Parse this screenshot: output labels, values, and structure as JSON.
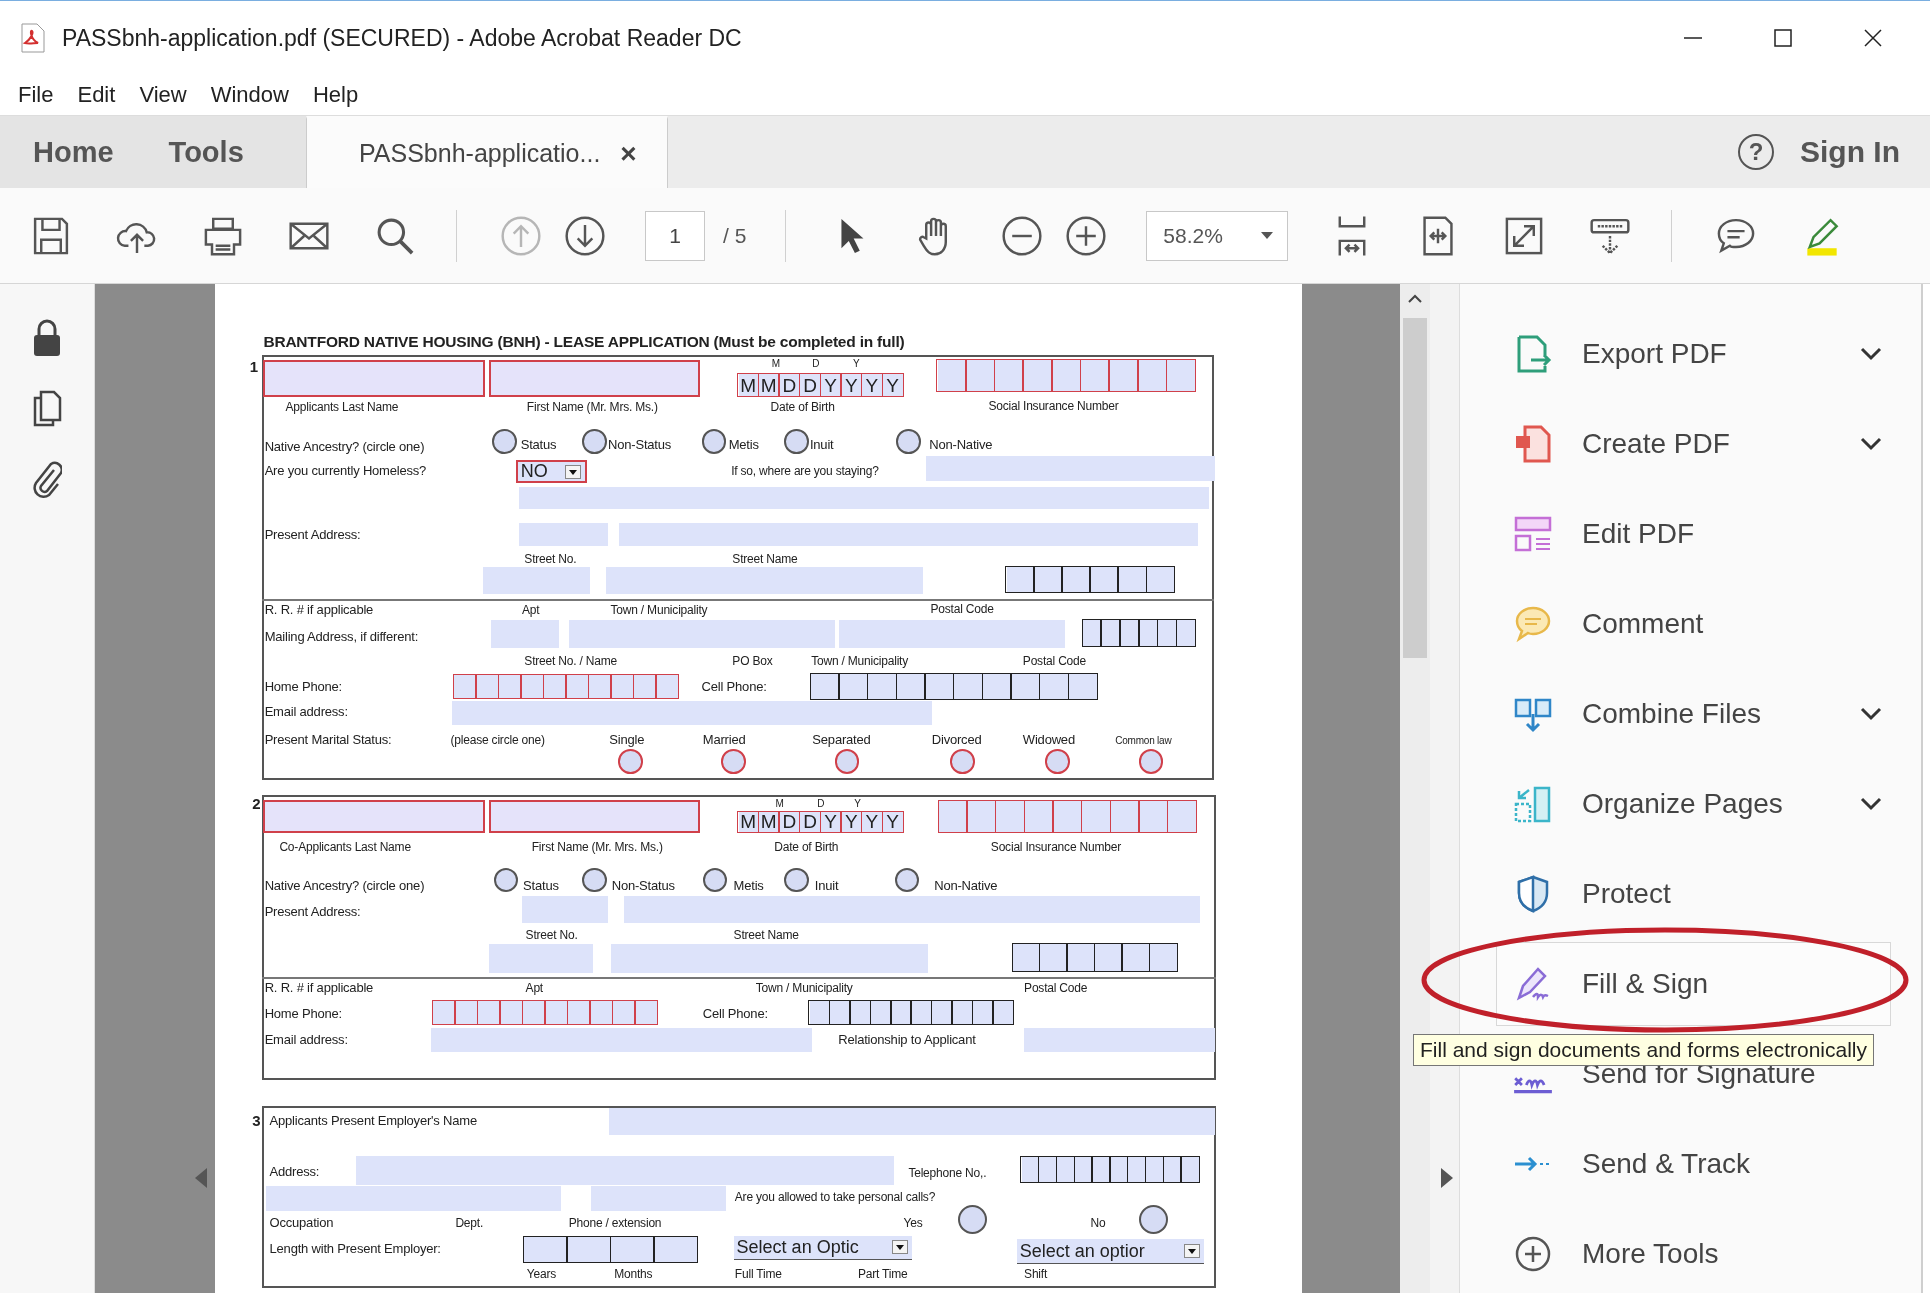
{
  "window": {
    "title": "PASSbnh-application.pdf (SECURED) - Adobe Acrobat Reader DC"
  },
  "menu": [
    "File",
    "Edit",
    "View",
    "Window",
    "Help"
  ],
  "tabs": [
    {
      "label": "Home",
      "selected": false
    },
    {
      "label": "Tools",
      "selected": false
    },
    {
      "label": "PASSbnh-applicatio...",
      "selected": true,
      "close": "×"
    }
  ],
  "help": "?",
  "sign_in": "Sign In",
  "toolbar": {
    "page": "1",
    "page_total": "/ 5",
    "zoom": "58.2%",
    "prev_disabled": true
  },
  "tools": [
    {
      "label": "Export PDF",
      "menu": true,
      "hovered": false
    },
    {
      "label": "Create PDF",
      "menu": true,
      "hovered": false
    },
    {
      "label": "Edit PDF",
      "menu": false,
      "hovered": false
    },
    {
      "label": "Comment",
      "menu": false,
      "hovered": false
    },
    {
      "label": "Combine Files",
      "menu": true,
      "hovered": false
    },
    {
      "label": "Organize Pages",
      "menu": true,
      "hovered": false
    },
    {
      "label": "Protect",
      "menu": false,
      "hovered": false
    },
    {
      "label": "Fill & Sign",
      "menu": false,
      "hovered": true
    },
    {
      "label": "Send for Signature",
      "menu": false,
      "hovered": false
    },
    {
      "label": "Send & Track",
      "menu": false,
      "hovered": false
    },
    {
      "label": "More Tools",
      "menu": false,
      "hovered": false
    }
  ],
  "tooltip": "Fill and sign documents and forms electronically",
  "form": {
    "title": "BRANTFORD NATIVE HOUSING (BNH) - LEASE APPLICATION (Must be completed in full)",
    "sections": [
      {
        "number": "1",
        "items": [
          {
            "kind": "field",
            "required": true
          },
          {
            "kind": "field",
            "required": true
          },
          {
            "kind": "label",
            "text": "M"
          },
          {
            "kind": "label",
            "text": "D"
          },
          {
            "kind": "label",
            "text": "Y"
          },
          {
            "kind": "cells",
            "required": true,
            "letters": [
              "M",
              "M",
              "D",
              "D",
              "Y",
              "Y",
              "Y",
              "Y"
            ]
          },
          {
            "kind": "cells",
            "required": true
          },
          {
            "kind": "label",
            "text": "Applicants Last Name"
          },
          {
            "kind": "label",
            "text": "First Name (Mr. Mrs. Ms.)"
          },
          {
            "kind": "label",
            "text": "Date of Birth"
          },
          {
            "kind": "label",
            "text": "Social Insurance Number"
          },
          {
            "kind": "label",
            "text": "Native Ancestry? (circle one)"
          },
          {
            "kind": "radio",
            "required": false,
            "selected": false
          },
          {
            "kind": "label",
            "text": "Status"
          },
          {
            "kind": "radio",
            "required": false,
            "selected": false
          },
          {
            "kind": "label",
            "text": "Non-Status"
          },
          {
            "kind": "radio",
            "required": false,
            "selected": false
          },
          {
            "kind": "label",
            "text": "Metis"
          },
          {
            "kind": "radio",
            "required": false,
            "selected": false
          },
          {
            "kind": "label",
            "text": "Inuit"
          },
          {
            "kind": "radio",
            "required": false,
            "selected": false
          },
          {
            "kind": "label",
            "text": "Non-Native"
          },
          {
            "kind": "label",
            "text": "Are you currently Homeless?"
          },
          {
            "kind": "select",
            "required": true,
            "value": "NO"
          },
          {
            "kind": "label",
            "text": "If so, where are you staying?"
          },
          {
            "kind": "field",
            "required": false
          },
          {
            "kind": "field",
            "required": false
          },
          {
            "kind": "label",
            "text": "Present Address:"
          },
          {
            "kind": "field",
            "required": false
          },
          {
            "kind": "field",
            "required": false
          },
          {
            "kind": "label",
            "text": "Street No."
          },
          {
            "kind": "label",
            "text": "Street Name"
          },
          {
            "kind": "field",
            "required": false
          },
          {
            "kind": "field",
            "required": false
          },
          {
            "kind": "cells",
            "required": false
          },
          {
            "kind": "label",
            "text": "R. R. # if applicable"
          },
          {
            "kind": "label",
            "text": "Apt"
          },
          {
            "kind": "label",
            "text": "Town / Municipality"
          },
          {
            "kind": "label",
            "text": "Postal Code"
          },
          {
            "kind": "label",
            "text": "Mailing Address, if different:"
          },
          {
            "kind": "field",
            "required": false
          },
          {
            "kind": "field",
            "required": false
          },
          {
            "kind": "field",
            "required": false
          },
          {
            "kind": "cells",
            "required": false
          },
          {
            "kind": "label",
            "text": "Street No. / Name"
          },
          {
            "kind": "label",
            "text": "PO Box"
          },
          {
            "kind": "label",
            "text": "Town / Municipality"
          },
          {
            "kind": "label",
            "text": "Postal Code"
          },
          {
            "kind": "label",
            "text": "Home Phone:"
          },
          {
            "kind": "cells",
            "required": true
          },
          {
            "kind": "label",
            "text": "Cell Phone:"
          },
          {
            "kind": "cells",
            "required": false
          },
          {
            "kind": "label",
            "text": "Email address:"
          },
          {
            "kind": "field",
            "required": false
          },
          {
            "kind": "label",
            "text": "Present Marital Status:"
          },
          {
            "kind": "label",
            "text": "(please circle one)"
          },
          {
            "kind": "label",
            "text": "Single"
          },
          {
            "kind": "label",
            "text": "Married"
          },
          {
            "kind": "label",
            "text": "Separated"
          },
          {
            "kind": "label",
            "text": "Divorced"
          },
          {
            "kind": "label",
            "text": "Widowed"
          },
          {
            "kind": "label",
            "text": "Common law"
          },
          {
            "kind": "radio",
            "required": true,
            "selected": false
          },
          {
            "kind": "radio",
            "required": true,
            "selected": false
          },
          {
            "kind": "radio",
            "required": true,
            "selected": false
          },
          {
            "kind": "radio",
            "required": true,
            "selected": false
          },
          {
            "kind": "radio",
            "required": true,
            "selected": false
          },
          {
            "kind": "radio",
            "required": true,
            "selected": false
          }
        ]
      },
      {
        "number": "2",
        "items": [
          {
            "kind": "field",
            "required": true
          },
          {
            "kind": "field",
            "required": true
          },
          {
            "kind": "label",
            "text": "M"
          },
          {
            "kind": "label",
            "text": "D"
          },
          {
            "kind": "label",
            "text": "Y"
          },
          {
            "kind": "cells",
            "required": true,
            "letters": [
              "M",
              "M",
              "D",
              "D",
              "Y",
              "Y",
              "Y",
              "Y"
            ]
          },
          {
            "kind": "cells",
            "required": true
          },
          {
            "kind": "label",
            "text": "Co-Applicants Last Name"
          },
          {
            "kind": "label",
            "text": "First Name (Mr. Mrs. Ms.)"
          },
          {
            "kind": "label",
            "text": "Date of Birth"
          },
          {
            "kind": "label",
            "text": "Social Insurance Number"
          },
          {
            "kind": "label",
            "text": "Native Ancestry? (circle one)"
          },
          {
            "kind": "radio",
            "required": false,
            "selected": false
          },
          {
            "kind": "label",
            "text": "Status"
          },
          {
            "kind": "radio",
            "required": false,
            "selected": false
          },
          {
            "kind": "label",
            "text": "Non-Status"
          },
          {
            "kind": "radio",
            "required": false,
            "selected": false
          },
          {
            "kind": "label",
            "text": "Metis"
          },
          {
            "kind": "radio",
            "required": false,
            "selected": false
          },
          {
            "kind": "label",
            "text": "Inuit"
          },
          {
            "kind": "radio",
            "required": false,
            "selected": false
          },
          {
            "kind": "label",
            "text": "Non-Native"
          },
          {
            "kind": "label",
            "text": "Present Address:"
          },
          {
            "kind": "field",
            "required": false
          },
          {
            "kind": "field",
            "required": false
          },
          {
            "kind": "label",
            "text": "Street No."
          },
          {
            "kind": "label",
            "text": "Street Name"
          },
          {
            "kind": "field",
            "required": false
          },
          {
            "kind": "field",
            "required": false
          },
          {
            "kind": "cells",
            "required": false
          },
          {
            "kind": "label",
            "text": "R. R. # if applicable"
          },
          {
            "kind": "label",
            "text": "Apt"
          },
          {
            "kind": "label",
            "text": "Town / Municipality"
          },
          {
            "kind": "label",
            "text": "Postal Code"
          },
          {
            "kind": "label",
            "text": "Home Phone:"
          },
          {
            "kind": "cells",
            "required": true
          },
          {
            "kind": "label",
            "text": "Cell Phone:"
          },
          {
            "kind": "cells",
            "required": false
          },
          {
            "kind": "label",
            "text": "Email address:"
          },
          {
            "kind": "field",
            "required": false
          },
          {
            "kind": "label",
            "text": "Relationship to Applicant"
          },
          {
            "kind": "field",
            "required": false
          }
        ]
      },
      {
        "number": "3",
        "items": [
          {
            "kind": "label",
            "text": "Applicants Present Employer's Name"
          },
          {
            "kind": "field",
            "required": false
          },
          {
            "kind": "label",
            "text": "Address:"
          },
          {
            "kind": "field",
            "required": false
          },
          {
            "kind": "label",
            "text": "Telephone No,."
          },
          {
            "kind": "cells",
            "required": false
          },
          {
            "kind": "field",
            "required": false
          },
          {
            "kind": "field",
            "required": false
          },
          {
            "kind": "label",
            "text": "Are you allowed to take personal calls?"
          },
          {
            "kind": "label",
            "text": "Occupation"
          },
          {
            "kind": "label",
            "text": "Dept."
          },
          {
            "kind": "label",
            "text": "Phone / extension"
          },
          {
            "kind": "label",
            "text": "Yes"
          },
          {
            "kind": "radio",
            "required": false,
            "selected": false
          },
          {
            "kind": "label",
            "text": "No"
          },
          {
            "kind": "radio",
            "required": false,
            "selected": false
          },
          {
            "kind": "label",
            "text": "Length with Present Employer:"
          },
          {
            "kind": "cells",
            "required": false
          },
          {
            "kind": "select",
            "required": false,
            "value": "Select an Optic"
          },
          {
            "kind": "select",
            "required": false,
            "value": "Select an optior"
          },
          {
            "kind": "label",
            "text": "Years"
          },
          {
            "kind": "label",
            "text": "Months"
          },
          {
            "kind": "label",
            "text": "Full Time"
          },
          {
            "kind": "label",
            "text": "Part Time"
          },
          {
            "kind": "label",
            "text": "Shift"
          }
        ]
      }
    ]
  }
}
